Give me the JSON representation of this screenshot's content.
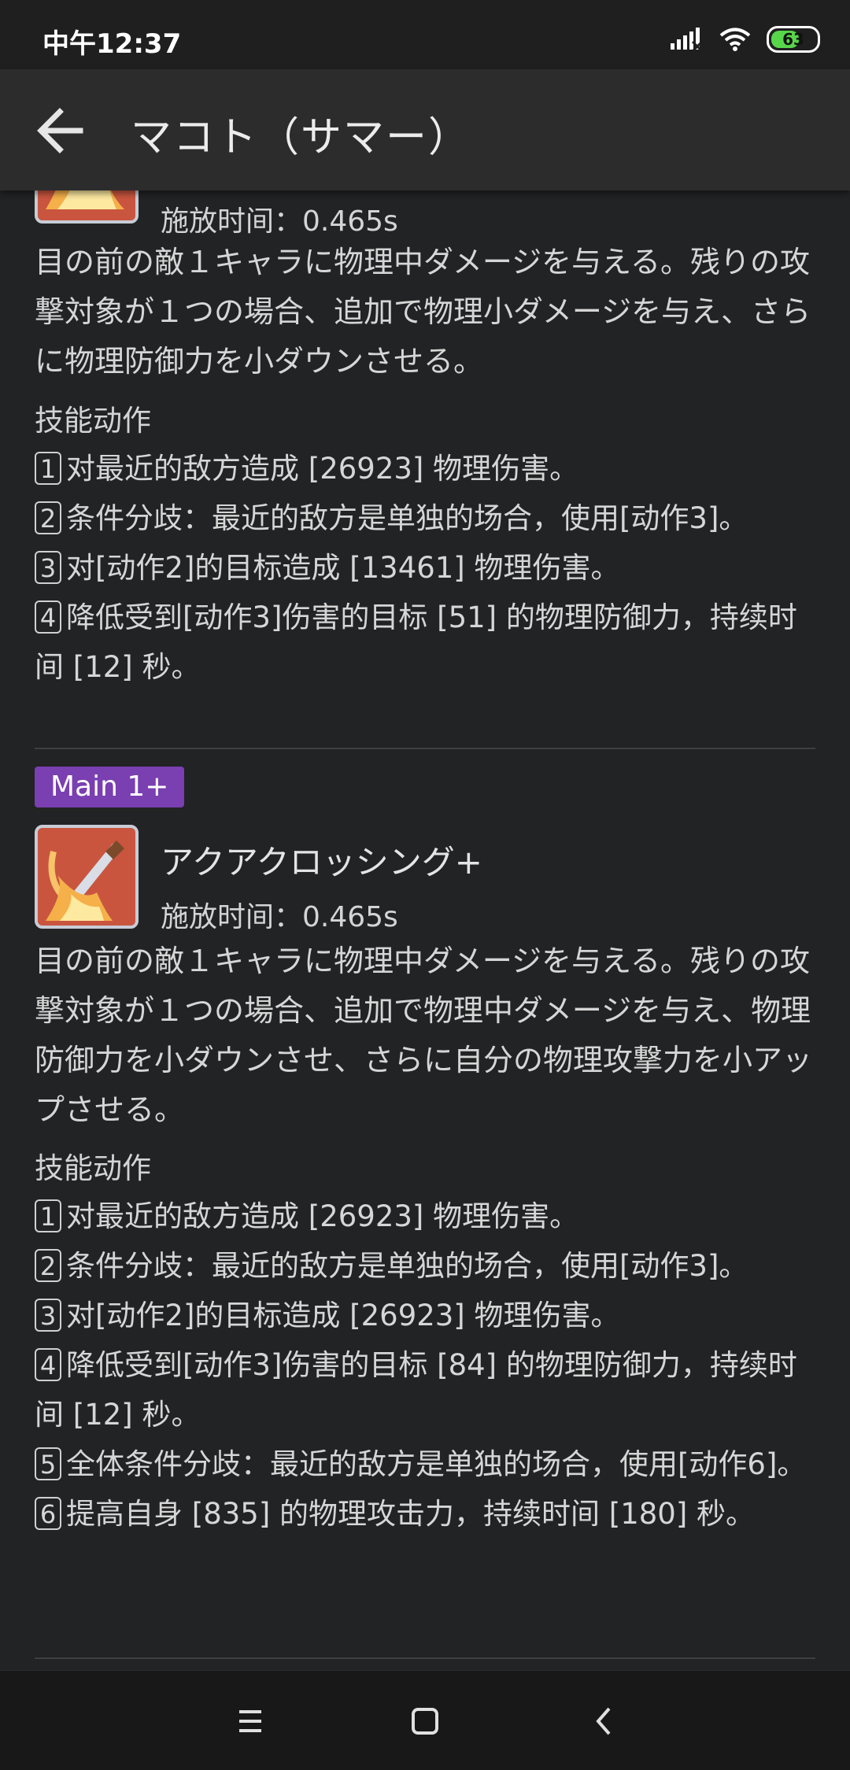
{
  "status_bar": {
    "time": "中午12:37",
    "battery": "63",
    "battery_level": 0.63,
    "icons": [
      "signal-icon",
      "wifi-icon",
      "battery-icon"
    ]
  },
  "app_bar": {
    "title": "マコト（サマー）",
    "back_icon": "arrow-left-icon"
  },
  "skill_top": {
    "cast_time": "施放时间：0.465s",
    "description": "目の前の敵１キャラに物理中ダメージを与える。残りの攻撃対象が１つの場合、追加で物理小ダメージを与え、さらに物理防御力を小ダウンさせる。",
    "section_label": "技能动作",
    "actions": [
      {
        "num": "1",
        "text": "对最近的敌方造成 [26923] 物理伤害。"
      },
      {
        "num": "2",
        "text": "条件分歧：最近的敌方是单独的场合，使用[动作3]。"
      },
      {
        "num": "3",
        "text": "对[动作2]的目标造成 [13461] 物理伤害。"
      },
      {
        "num": "4",
        "text": "降低受到[动作3]伤害的目标 [51] 的物理防御力，持续时间 [12] 秒。"
      }
    ]
  },
  "skill_main": {
    "badge": "Main 1+",
    "name": "アクアクロッシング+",
    "cast_time": "施放时间：0.465s",
    "description": "目の前の敵１キャラに物理中ダメージを与える。残りの攻撃対象が１つの場合、追加で物理中ダメージを与え、物理防御力を小ダウンさせ、さらに自分の物理攻撃力を小アップさせる。",
    "section_label": "技能动作",
    "actions": [
      {
        "num": "1",
        "text": "对最近的敌方造成 [26923] 物理伤害。"
      },
      {
        "num": "2",
        "text": "条件分歧：最近的敌方是单独的场合，使用[动作3]。"
      },
      {
        "num": "3",
        "text": "对[动作2]的目标造成 [26923] 物理伤害。"
      },
      {
        "num": "4",
        "text": "降低受到[动作3]伤害的目标 [84] 的物理防御力，持续时间 [12] 秒。"
      },
      {
        "num": "5",
        "text": "全体条件分歧：最近的敌方是单独的场合，使用[动作6]。"
      },
      {
        "num": "6",
        "text": "提高自身 [835] 的物理攻击力，持续时间 [180] 秒。"
      }
    ]
  },
  "nav_bar": {
    "icons": [
      "menu-icon",
      "home-icon",
      "back-icon"
    ]
  },
  "colors": {
    "background": "#222324",
    "app_bar": "#2c2c2d",
    "badge": "#7a3fb0",
    "skill_icon": "#c84f3b"
  }
}
